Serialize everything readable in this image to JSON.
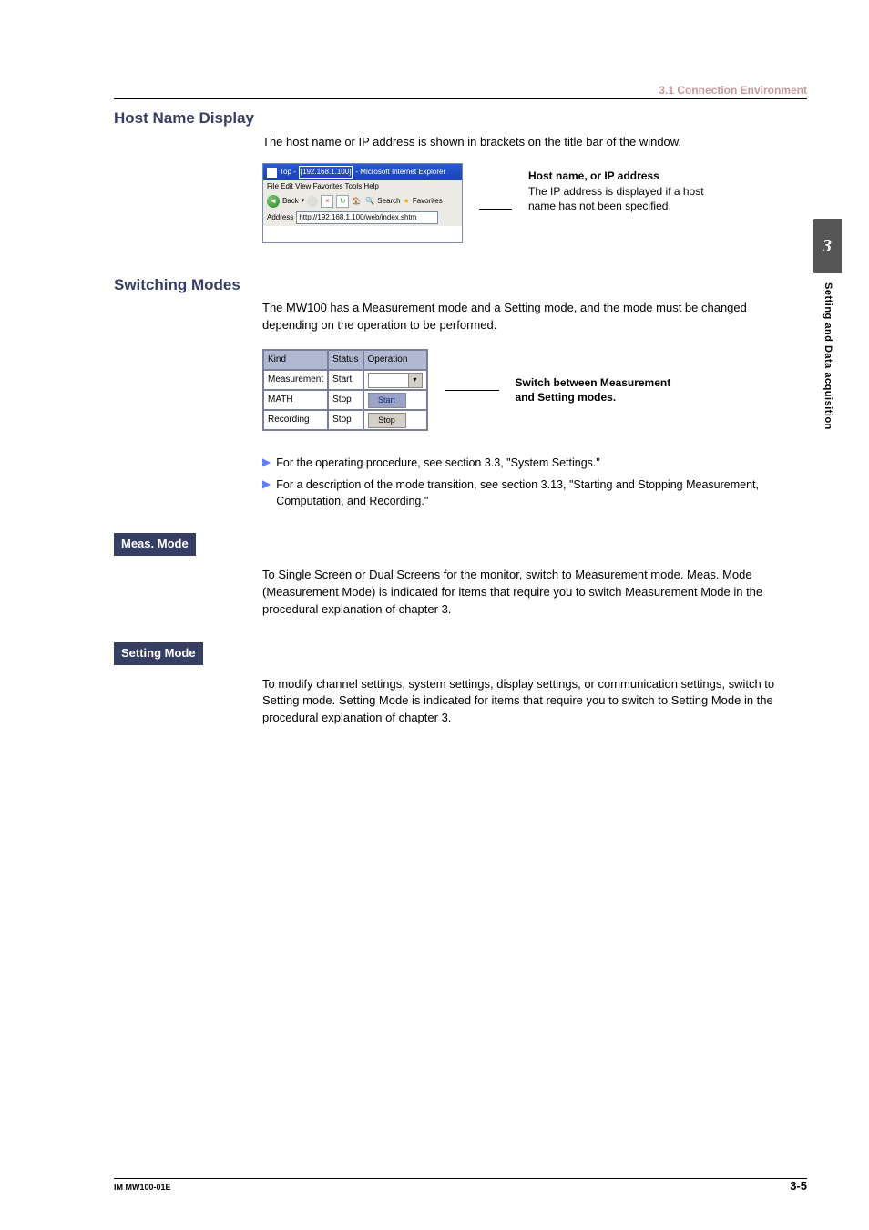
{
  "header": {
    "section": "3.1  Connection Environment"
  },
  "sidetab": {
    "chapter": "3",
    "label": "Setting and Data acquisition"
  },
  "host_display": {
    "heading": "Host Name Display",
    "intro": "The host name or IP address is shown in brackets on the title bar of the window.",
    "ie": {
      "title_prefix": "Top -",
      "title_ip": "[192.168.1.100]",
      "title_suffix": "- Microsoft Internet Explorer",
      "menu": "File   Edit   View   Favorites   Tools   Help",
      "back": "Back",
      "search": "Search",
      "favorites": "Favorites",
      "addr_label": "Address",
      "addr_value": "http://192.168.1.100/web/index.shtm"
    },
    "callout": {
      "title": "Host name, or IP address",
      "line1": "The IP address is displayed if a host",
      "line2": "name has not been specified."
    }
  },
  "switching": {
    "heading": "Switching Modes",
    "intro": "The MW100 has a Measurement mode and a Setting mode, and the mode must be changed depending on the operation to be performed.",
    "table": {
      "headers": [
        "Kind",
        "Status",
        "Operation"
      ],
      "rows": [
        {
          "kind": "Measurement",
          "status": "Start",
          "op_type": "dropdown"
        },
        {
          "kind": "MATH",
          "status": "Stop",
          "op_type": "button",
          "op_label": "Start"
        },
        {
          "kind": "Recording",
          "status": "Stop",
          "op_type": "button",
          "op_label": "Stop"
        }
      ]
    },
    "callout": {
      "line1": "Switch between Measurement",
      "line2": "and Setting modes."
    },
    "refs": [
      "For the operating procedure, see section 3.3, \"System Settings.\"",
      "For a description of the mode transition, see section 3.13, \"Starting and Stopping Measurement, Computation, and Recording.\""
    ]
  },
  "meas_mode": {
    "label": "Meas. Mode",
    "text": "To Single Screen or Dual Screens for the monitor, switch to Measurement mode. Meas. Mode (Measurement Mode) is indicated for items that require you to switch Measurement Mode in the procedural explanation of chapter 3."
  },
  "setting_mode": {
    "label": "Setting Mode",
    "text": "To modify channel settings, system settings, display settings, or communication settings, switch to Setting mode. Setting Mode is indicated for items that require you to switch to Setting Mode in the procedural explanation of chapter 3."
  },
  "footer": {
    "left": "IM MW100-01E",
    "right": "3-5"
  }
}
